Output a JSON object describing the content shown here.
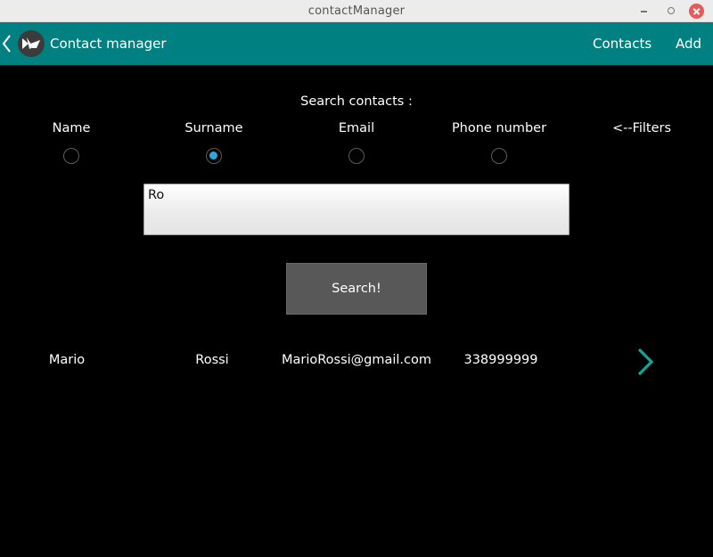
{
  "window": {
    "title": "contactManager"
  },
  "actionbar": {
    "title": "Contact manager",
    "nav": {
      "contacts": "Contacts",
      "add": "Add"
    },
    "accent_color": "#008080"
  },
  "search": {
    "heading": "Search contacts :",
    "filters": [
      {
        "label": "Name",
        "selected": false
      },
      {
        "label": "Surname",
        "selected": true
      },
      {
        "label": "Email",
        "selected": false
      },
      {
        "label": "Phone number",
        "selected": false
      },
      {
        "label": "<--Filters"
      }
    ],
    "query": "Ro",
    "button_label": "Search!"
  },
  "results": [
    {
      "name": "Mario",
      "surname": "Rossi",
      "email": "MarioRossi@gmail.com",
      "phone": "338999999"
    }
  ],
  "icons": {
    "back": "chevron-left-icon",
    "logo": "kivy-logo-icon",
    "open_contact": "chevron-right-icon"
  }
}
